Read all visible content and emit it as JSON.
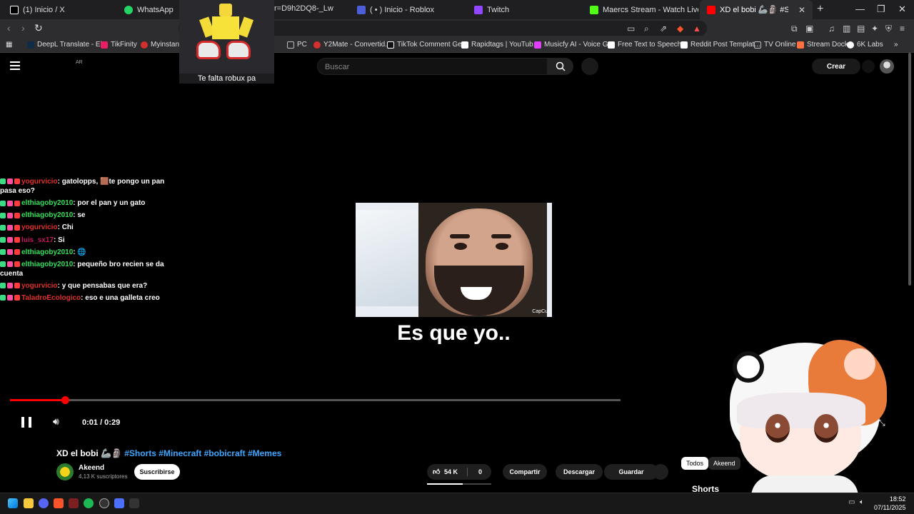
{
  "browser": {
    "tabs": [
      {
        "label": "(1) Inicio / X",
        "color": "#000000"
      },
      {
        "label": "WhatsApp",
        "color": "#25d366"
      },
      {
        "label": "( • ) Inicio - Roblox",
        "color": "#4c5fd7"
      },
      {
        "label": "Twitch",
        "color": "#9146ff"
      },
      {
        "label": "Maercs Stream - Watch Live on K",
        "color": "#53fc18"
      },
      {
        "label": "XD el bobi 🦾🗿 #Shorts #M",
        "color": "#ff0000"
      }
    ],
    "url": "r=D9h2DQ8-_Lw",
    "bookmarks": [
      {
        "label": "DeepL Translate - El...",
        "color": "#0f2b46"
      },
      {
        "label": "TikFinity",
        "color": "#e91e63"
      },
      {
        "label": "Myinstants",
        "color": "#d32f2f"
      },
      {
        "label": "PC",
        "color": "#888888"
      },
      {
        "label": "Y2Mate - Convertid...",
        "color": "#d32f2f"
      },
      {
        "label": "TikTok Comment Ge...",
        "color": "#111111"
      },
      {
        "label": "Rapidtags | YouTub...",
        "color": "#ffffff"
      },
      {
        "label": "Musicfy AI - Voice G...",
        "color": "#e040fb"
      },
      {
        "label": "Free Text to Speech...",
        "color": "#ffffff"
      },
      {
        "label": "Reddit Post Templat...",
        "color": "#ffffff"
      },
      {
        "label": "TV Online",
        "color": "#888888"
      },
      {
        "label": "Stream Dock",
        "color": "#ff7043"
      },
      {
        "label": "6K Labs",
        "color": "#ffffff"
      }
    ]
  },
  "youtube": {
    "search_placeholder": "Buscar",
    "create_label": "Crear",
    "cc_tag": "AR",
    "caption_overlay": "Es que yo..",
    "video_watermark": "CapCut",
    "time": "0:01 / 0:29",
    "progress_fraction": 0.09,
    "title_plain": "XD el bobi 🦾🗿 ",
    "title_tags": "#Shorts #Minecraft #bobicraft #Memes",
    "channel_name": "Akeend",
    "channel_subs": "4,13 K suscriptores",
    "subscribe_label": "Suscribirse",
    "likes": "54 K",
    "dislikes": "0",
    "share_label": "Compartir",
    "download_label": "Descargar",
    "save_label": "Guardar",
    "filter_all": "Todos",
    "filter_channel": "Akeend",
    "shorts_heading": "Shorts"
  },
  "roblox_overlay": {
    "text": "Te falta robux pa"
  },
  "chat": [
    {
      "user": "yogurvicio",
      "color": "#e0302a",
      "text": "gatolopps, 🟫te pongo un pan pasa eso?"
    },
    {
      "user": "elthiagoby2010",
      "color": "#33e05a",
      "text": "por el pan y un gato"
    },
    {
      "user": "elthiagoby2010",
      "color": "#33e05a",
      "text": "se"
    },
    {
      "user": "yogurvicio",
      "color": "#e0302a",
      "text": "Chi"
    },
    {
      "user": "luis_sx17",
      "color": "#c2185b",
      "text": "Si"
    },
    {
      "user": "elthiagoby2010",
      "color": "#33e05a",
      "text": "🌐"
    },
    {
      "user": "elthiagoby2010",
      "color": "#33e05a",
      "text": "pequeño bro recien se da cuenta"
    },
    {
      "user": "yogurvicio",
      "color": "#e0302a",
      "text": "y que pensabas que era?"
    },
    {
      "user": "TaladroEcologico",
      "color": "#e0302a",
      "text": "eso e una galleta creo"
    }
  ],
  "taskbar": {
    "time": "18:52",
    "date": "07/11/2025"
  }
}
